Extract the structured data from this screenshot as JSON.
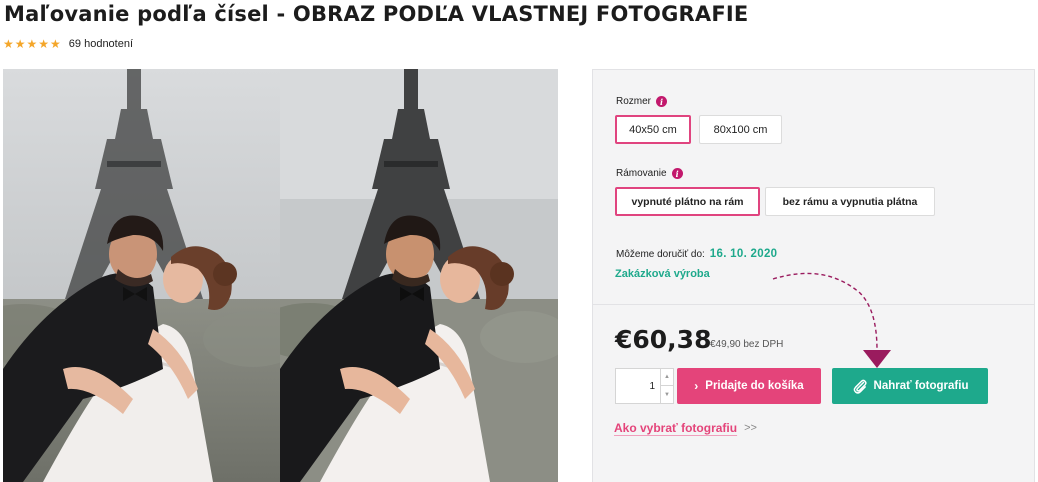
{
  "product": {
    "title": "Maľovanie podľa čísel - OBRAZ PODĽA VLASTNEJ FOTOGRAFIE",
    "stars": "★★★★★",
    "rating_count": "69 hodnotení"
  },
  "options": {
    "size": {
      "label": "Rozmer",
      "choices": [
        "40x50 cm",
        "80x100 cm"
      ],
      "selected": "40x50 cm"
    },
    "frame": {
      "label": "Rámovanie",
      "choices": [
        "vypnuté plátno na rám",
        "bez rámu a vypnutia plátna"
      ],
      "selected": "vypnuté plátno na rám"
    },
    "info_icon": "info-icon"
  },
  "delivery": {
    "label": "Môžeme doručiť do:",
    "date": "16. 10. 2020",
    "custom": "Zakázková výroba"
  },
  "pricing": {
    "price": "€60,38",
    "net_price": "€49,90 bez DPH"
  },
  "cart": {
    "quantity": "1",
    "add_label": "Pridajte do košíka",
    "add_icon": "chevron-right-icon",
    "upload_label": "Nahrať fotografiu",
    "upload_icon": "paperclip-icon"
  },
  "links": {
    "how_to": "Ako vybrať fotografiu",
    "how_to_arrows": ">>"
  },
  "colors": {
    "accent_pink": "#e4447a",
    "accent_green": "#1ea98c",
    "info_magenta": "#c2186c",
    "star": "#f4a62a"
  }
}
